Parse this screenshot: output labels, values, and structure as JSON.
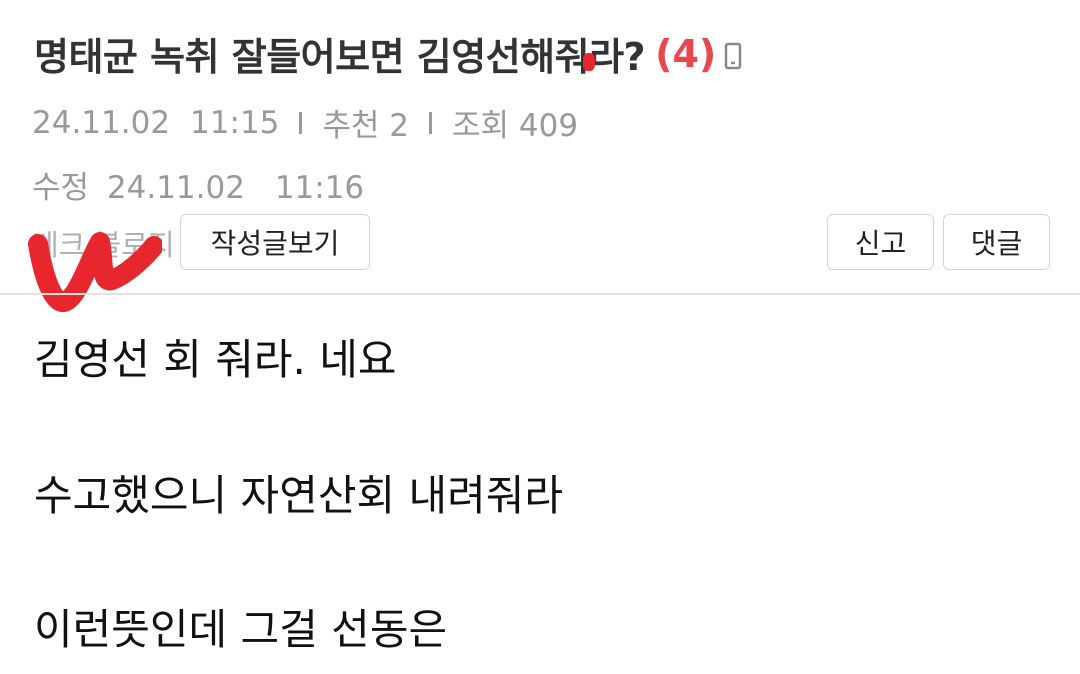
{
  "post": {
    "title": "명태균 녹취 잘들어보면 김영선해줘라?",
    "comment_count": "(4)",
    "mobile_icon": "mobile-phone-icon",
    "date": "24.11.02",
    "time": "11:15",
    "recommend": "추천 2",
    "views": "조회 409",
    "edit_label": "수정",
    "edit_date": "24.11.02",
    "edit_time": "11:16"
  },
  "actions": {
    "blog_link": "베크 블로지",
    "view_posts": "작성글보기",
    "report": "신고",
    "comment": "댓글"
  },
  "content": {
    "lines": [
      "김영선 회 줘라. 네요",
      "수고했으니 자연산회 내려줘라",
      "이런뜻인데 그걸 선동은"
    ]
  },
  "colors": {
    "title": "#333333",
    "comment_count": "#e8484d",
    "meta": "#999999",
    "scribble": "#e8262d",
    "border": "#d5d5d5"
  }
}
